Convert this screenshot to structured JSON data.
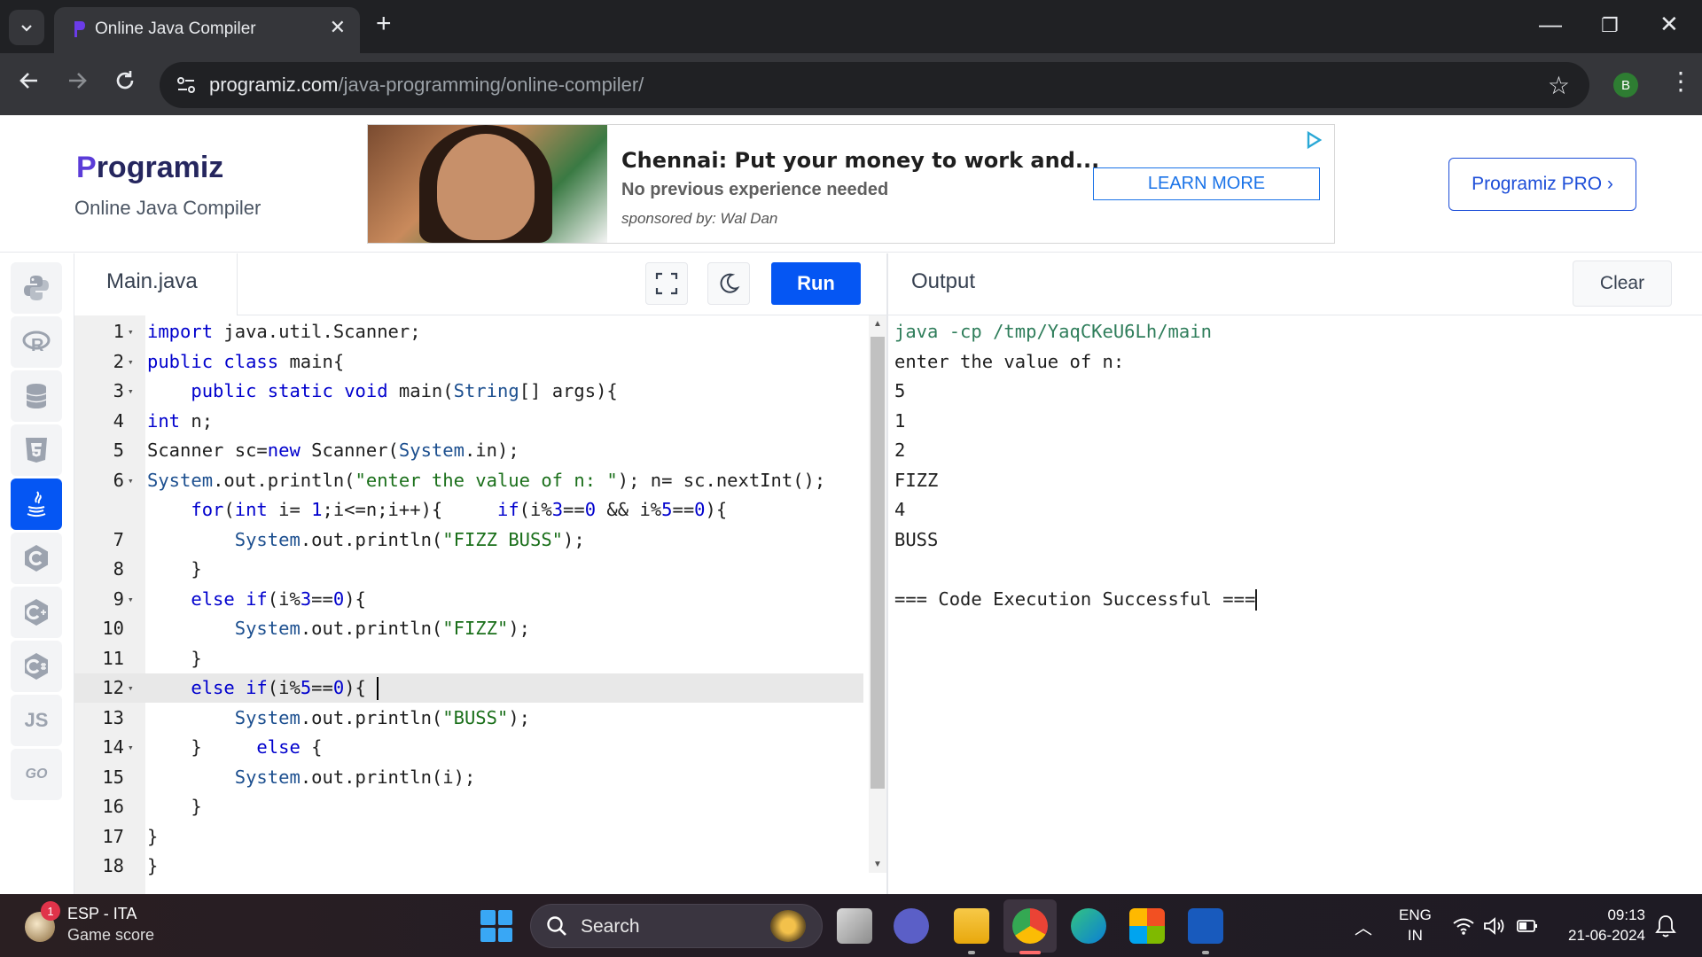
{
  "browser": {
    "tab_title": "Online Java Compiler",
    "url_host": "programiz.com",
    "url_path": "/java-programming/online-compiler/",
    "profile_initial": "B"
  },
  "site": {
    "logo_text": "Programiz",
    "subtitle": "Online Java Compiler",
    "pro_button": "Programiz PRO ›"
  },
  "ad": {
    "title": "Chennai: Put your money to work and...",
    "subtitle": "No previous experience needed",
    "sponsor": "sponsored by: Wal Dan",
    "cta": "LEARN MORE"
  },
  "sidebar": {
    "languages": [
      "python",
      "r",
      "sql",
      "html",
      "java",
      "c",
      "cpp",
      "csharp",
      "js",
      "go"
    ],
    "active": "java",
    "js_label": "JS",
    "go_label": "GO"
  },
  "editor": {
    "file_name": "Main.java",
    "run_label": "Run",
    "current_line": "12",
    "lines": [
      {
        "num": "1",
        "fold": true,
        "text": "import java.util.Scanner;"
      },
      {
        "num": "2",
        "fold": true,
        "text": "public class main{"
      },
      {
        "num": "3",
        "fold": true,
        "text": "    public static void main(String[] args){"
      },
      {
        "num": "4",
        "fold": false,
        "text": "int n;"
      },
      {
        "num": "5",
        "fold": false,
        "text": "Scanner sc=new Scanner(System.in);"
      },
      {
        "num": "6",
        "fold": true,
        "text": "System.out.println(\"enter the value of n: \"); n= sc.nextInt();"
      },
      {
        "num": "",
        "fold": false,
        "text": "    for(int i= 1;i<=n;i++){     if(i%3==0 && i%5==0){"
      },
      {
        "num": "7",
        "fold": false,
        "text": "        System.out.println(\"FIZZ BUSS\");"
      },
      {
        "num": "8",
        "fold": false,
        "text": "    }"
      },
      {
        "num": "9",
        "fold": true,
        "text": "    else if(i%3==0){"
      },
      {
        "num": "10",
        "fold": false,
        "text": "        System.out.println(\"FIZZ\");"
      },
      {
        "num": "11",
        "fold": false,
        "text": "    }"
      },
      {
        "num": "12",
        "fold": true,
        "text": "    else if(i%5==0){ "
      },
      {
        "num": "13",
        "fold": false,
        "text": "        System.out.println(\"BUSS\");"
      },
      {
        "num": "14",
        "fold": true,
        "text": "    }     else {"
      },
      {
        "num": "15",
        "fold": false,
        "text": "        System.out.println(i);"
      },
      {
        "num": "16",
        "fold": false,
        "text": "    }"
      },
      {
        "num": "17",
        "fold": false,
        "text": "}"
      },
      {
        "num": "18",
        "fold": false,
        "text": "}"
      }
    ]
  },
  "output": {
    "title": "Output",
    "clear_label": "Clear",
    "lines": [
      "java -cp /tmp/YaqCKeU6Lh/main",
      "enter the value of n:",
      "5",
      "1",
      "2",
      "FIZZ",
      "4",
      "BUSS",
      "",
      "=== Code Execution Successful ==="
    ]
  },
  "taskbar": {
    "news_title": "ESP - ITA",
    "news_sub": "Game score",
    "news_badge": "1",
    "search_label": "Search",
    "lang_top": "ENG",
    "lang_bottom": "IN",
    "time": "09:13",
    "date": "21-06-2024"
  },
  "colors": {
    "accent": "#0556f3",
    "chrome_dark": "#202124",
    "chrome_toolbar": "#35363a"
  }
}
